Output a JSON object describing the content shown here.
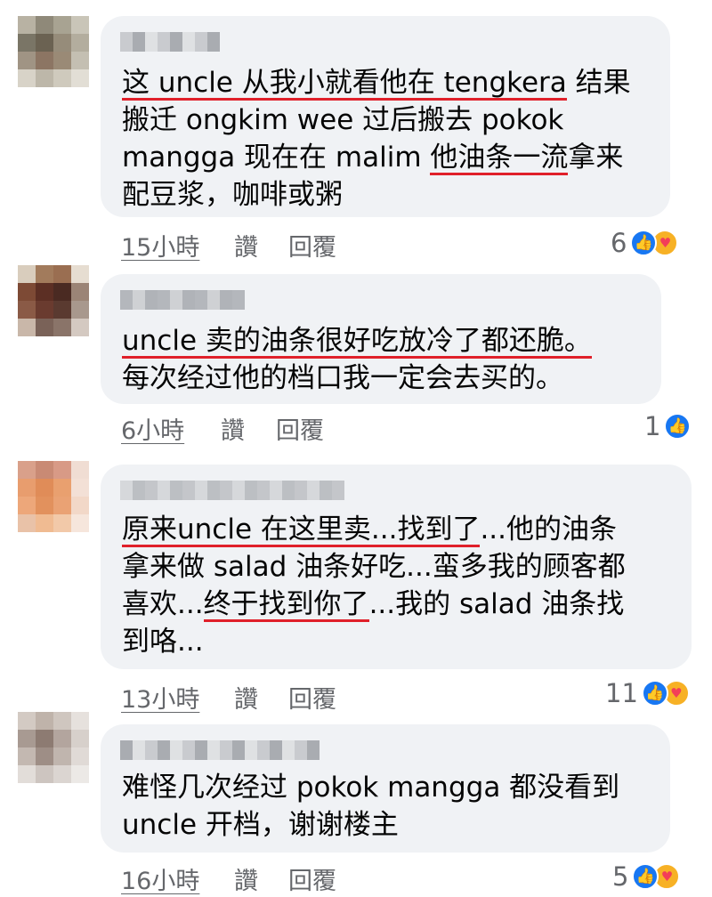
{
  "comments": [
    {
      "lines": [
        [
          {
            "t": "这 uncle 从我小就看他在 tengkera",
            "u": true
          },
          {
            "t": " 结果",
            "u": false
          }
        ],
        [
          {
            "t": "搬迁 ongkim wee 过后搬去 pokok",
            "u": false
          }
        ],
        [
          {
            "t": "mangga 现在在 malim ",
            "u": false
          },
          {
            "t": "他油条一流",
            "u": true
          },
          {
            "t": "拿来",
            "u": false
          }
        ],
        [
          {
            "t": "配豆浆，咖啡或粥",
            "u": false
          }
        ]
      ],
      "time": "15小時",
      "like_label": "讚",
      "reply_label": "回覆",
      "reaction_count": "6",
      "reactions": [
        "like-icon",
        "care-icon"
      ]
    },
    {
      "lines": [
        [
          {
            "t": "uncle 卖的油条很好吃放冷了都还脆。",
            "u": true
          }
        ],
        [
          {
            "t": "每次经过他的档口我一定会去买的。",
            "u": false
          }
        ]
      ],
      "time": "6小時",
      "like_label": "讚",
      "reply_label": "回覆",
      "reaction_count": "1",
      "reactions": [
        "like-icon"
      ]
    },
    {
      "lines": [
        [
          {
            "t": "原来uncle 在这里卖...找到了",
            "u": true
          },
          {
            "t": "...他的油条",
            "u": false
          }
        ],
        [
          {
            "t": "拿来做 salad 油条好吃...蛮多我的顾客都",
            "u": false
          }
        ],
        [
          {
            "t": "喜欢...",
            "u": false
          },
          {
            "t": "终于找到你了",
            "u": true
          },
          {
            "t": "...我的 salad 油条找",
            "u": false
          }
        ],
        [
          {
            "t": "到咯...",
            "u": false
          }
        ]
      ],
      "time": "13小時",
      "like_label": "讚",
      "reply_label": "回覆",
      "reaction_count": "11",
      "reactions": [
        "like-icon",
        "care-icon"
      ]
    },
    {
      "lines": [
        [
          {
            "t": "难怪几次经过 pokok mangga 都没看到",
            "u": false
          }
        ],
        [
          {
            "t": "uncle 开档，谢谢楼主",
            "u": false
          }
        ]
      ],
      "time": "16小時",
      "like_label": "讚",
      "reply_label": "回覆",
      "reaction_count": "5",
      "reactions": [
        "like-icon",
        "care-icon"
      ]
    }
  ],
  "colors": {
    "bubble_bg": "#f0f2f5",
    "underline": "#e0202a",
    "meta_text": "#65676b",
    "like_blue": "#1877f2",
    "care_yellow": "#f7b125"
  }
}
